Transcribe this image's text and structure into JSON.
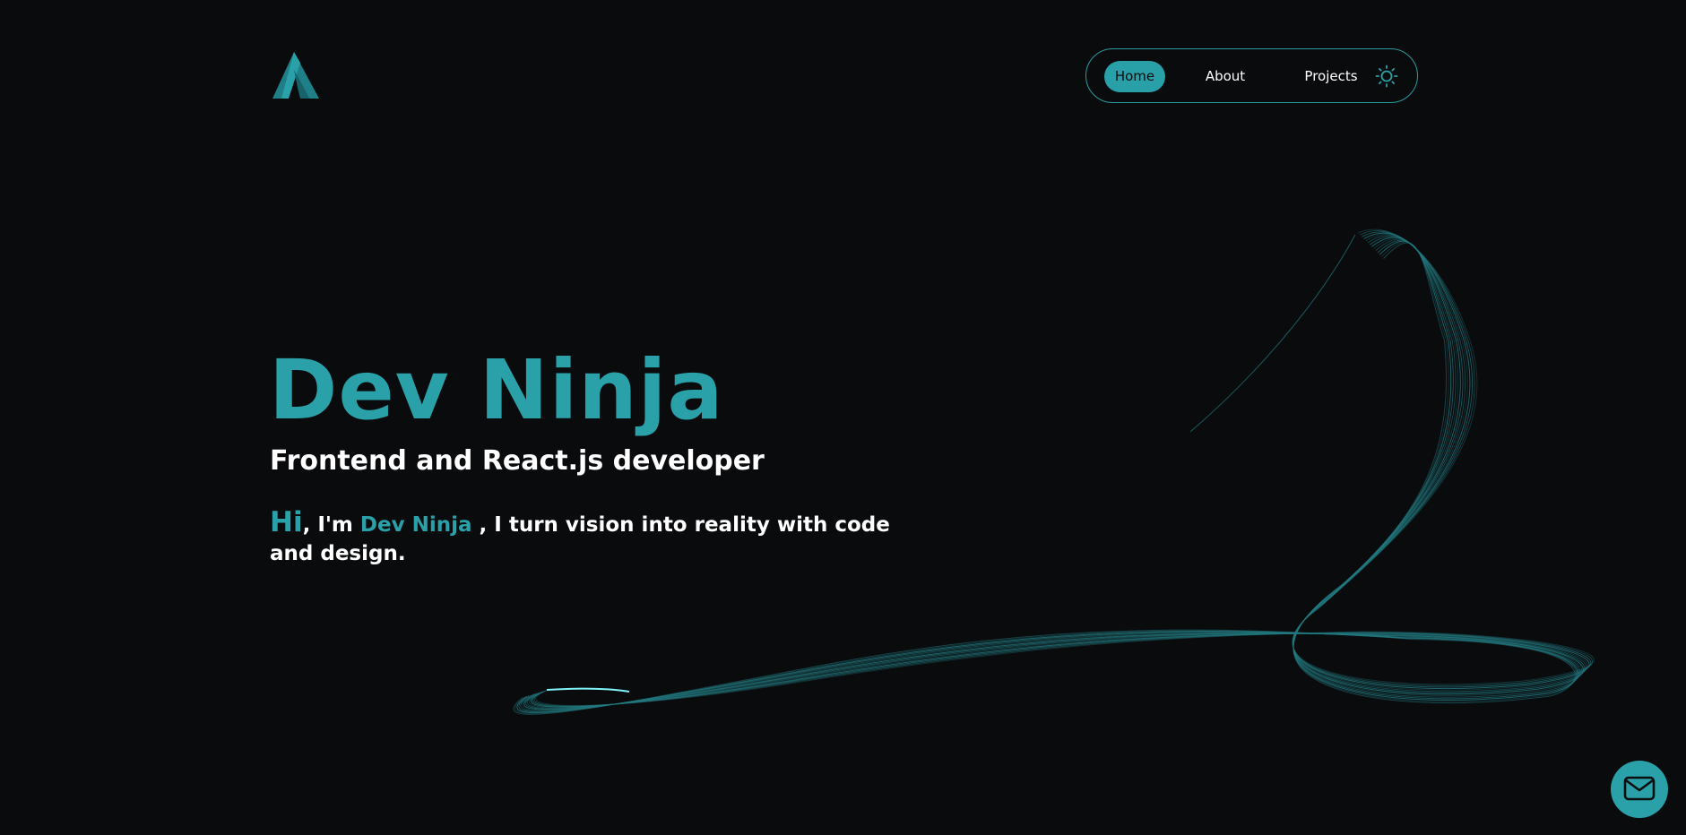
{
  "brand": {
    "logo_icon": "triangle-a-logo-icon",
    "accent_color": "#2aa1a9",
    "background_color": "#0a0b0d"
  },
  "nav": {
    "items": [
      {
        "label": "Home",
        "active": true
      },
      {
        "label": "About",
        "active": false
      },
      {
        "label": "Projects",
        "active": false
      }
    ],
    "theme_toggle_icon": "sun-icon"
  },
  "hero": {
    "title": "Dev Ninja",
    "subtitle": "Frontend and React.js developer",
    "intro": {
      "greeting": "Hi",
      "prefix": ", I'm ",
      "name": "Dev Ninja",
      "suffix": " , I turn vision into reality with code and design."
    }
  },
  "contact_button": {
    "icon": "mail-icon"
  }
}
